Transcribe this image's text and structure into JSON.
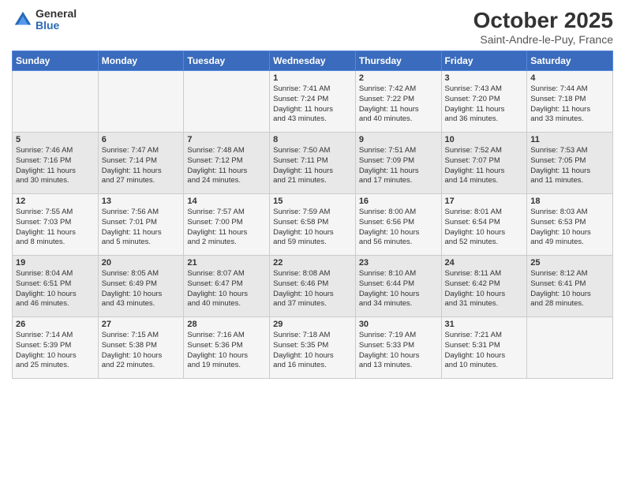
{
  "header": {
    "logo_general": "General",
    "logo_blue": "Blue",
    "title": "October 2025",
    "location": "Saint-Andre-le-Puy, France"
  },
  "days_of_week": [
    "Sunday",
    "Monday",
    "Tuesday",
    "Wednesday",
    "Thursday",
    "Friday",
    "Saturday"
  ],
  "weeks": [
    [
      {
        "day": "",
        "content": ""
      },
      {
        "day": "",
        "content": ""
      },
      {
        "day": "",
        "content": ""
      },
      {
        "day": "1",
        "content": "Sunrise: 7:41 AM\nSunset: 7:24 PM\nDaylight: 11 hours\nand 43 minutes."
      },
      {
        "day": "2",
        "content": "Sunrise: 7:42 AM\nSunset: 7:22 PM\nDaylight: 11 hours\nand 40 minutes."
      },
      {
        "day": "3",
        "content": "Sunrise: 7:43 AM\nSunset: 7:20 PM\nDaylight: 11 hours\nand 36 minutes."
      },
      {
        "day": "4",
        "content": "Sunrise: 7:44 AM\nSunset: 7:18 PM\nDaylight: 11 hours\nand 33 minutes."
      }
    ],
    [
      {
        "day": "5",
        "content": "Sunrise: 7:46 AM\nSunset: 7:16 PM\nDaylight: 11 hours\nand 30 minutes."
      },
      {
        "day": "6",
        "content": "Sunrise: 7:47 AM\nSunset: 7:14 PM\nDaylight: 11 hours\nand 27 minutes."
      },
      {
        "day": "7",
        "content": "Sunrise: 7:48 AM\nSunset: 7:12 PM\nDaylight: 11 hours\nand 24 minutes."
      },
      {
        "day": "8",
        "content": "Sunrise: 7:50 AM\nSunset: 7:11 PM\nDaylight: 11 hours\nand 21 minutes."
      },
      {
        "day": "9",
        "content": "Sunrise: 7:51 AM\nSunset: 7:09 PM\nDaylight: 11 hours\nand 17 minutes."
      },
      {
        "day": "10",
        "content": "Sunrise: 7:52 AM\nSunset: 7:07 PM\nDaylight: 11 hours\nand 14 minutes."
      },
      {
        "day": "11",
        "content": "Sunrise: 7:53 AM\nSunset: 7:05 PM\nDaylight: 11 hours\nand 11 minutes."
      }
    ],
    [
      {
        "day": "12",
        "content": "Sunrise: 7:55 AM\nSunset: 7:03 PM\nDaylight: 11 hours\nand 8 minutes."
      },
      {
        "day": "13",
        "content": "Sunrise: 7:56 AM\nSunset: 7:01 PM\nDaylight: 11 hours\nand 5 minutes."
      },
      {
        "day": "14",
        "content": "Sunrise: 7:57 AM\nSunset: 7:00 PM\nDaylight: 11 hours\nand 2 minutes."
      },
      {
        "day": "15",
        "content": "Sunrise: 7:59 AM\nSunset: 6:58 PM\nDaylight: 10 hours\nand 59 minutes."
      },
      {
        "day": "16",
        "content": "Sunrise: 8:00 AM\nSunset: 6:56 PM\nDaylight: 10 hours\nand 56 minutes."
      },
      {
        "day": "17",
        "content": "Sunrise: 8:01 AM\nSunset: 6:54 PM\nDaylight: 10 hours\nand 52 minutes."
      },
      {
        "day": "18",
        "content": "Sunrise: 8:03 AM\nSunset: 6:53 PM\nDaylight: 10 hours\nand 49 minutes."
      }
    ],
    [
      {
        "day": "19",
        "content": "Sunrise: 8:04 AM\nSunset: 6:51 PM\nDaylight: 10 hours\nand 46 minutes."
      },
      {
        "day": "20",
        "content": "Sunrise: 8:05 AM\nSunset: 6:49 PM\nDaylight: 10 hours\nand 43 minutes."
      },
      {
        "day": "21",
        "content": "Sunrise: 8:07 AM\nSunset: 6:47 PM\nDaylight: 10 hours\nand 40 minutes."
      },
      {
        "day": "22",
        "content": "Sunrise: 8:08 AM\nSunset: 6:46 PM\nDaylight: 10 hours\nand 37 minutes."
      },
      {
        "day": "23",
        "content": "Sunrise: 8:10 AM\nSunset: 6:44 PM\nDaylight: 10 hours\nand 34 minutes."
      },
      {
        "day": "24",
        "content": "Sunrise: 8:11 AM\nSunset: 6:42 PM\nDaylight: 10 hours\nand 31 minutes."
      },
      {
        "day": "25",
        "content": "Sunrise: 8:12 AM\nSunset: 6:41 PM\nDaylight: 10 hours\nand 28 minutes."
      }
    ],
    [
      {
        "day": "26",
        "content": "Sunrise: 7:14 AM\nSunset: 5:39 PM\nDaylight: 10 hours\nand 25 minutes."
      },
      {
        "day": "27",
        "content": "Sunrise: 7:15 AM\nSunset: 5:38 PM\nDaylight: 10 hours\nand 22 minutes."
      },
      {
        "day": "28",
        "content": "Sunrise: 7:16 AM\nSunset: 5:36 PM\nDaylight: 10 hours\nand 19 minutes."
      },
      {
        "day": "29",
        "content": "Sunrise: 7:18 AM\nSunset: 5:35 PM\nDaylight: 10 hours\nand 16 minutes."
      },
      {
        "day": "30",
        "content": "Sunrise: 7:19 AM\nSunset: 5:33 PM\nDaylight: 10 hours\nand 13 minutes."
      },
      {
        "day": "31",
        "content": "Sunrise: 7:21 AM\nSunset: 5:31 PM\nDaylight: 10 hours\nand 10 minutes."
      },
      {
        "day": "",
        "content": ""
      }
    ]
  ]
}
